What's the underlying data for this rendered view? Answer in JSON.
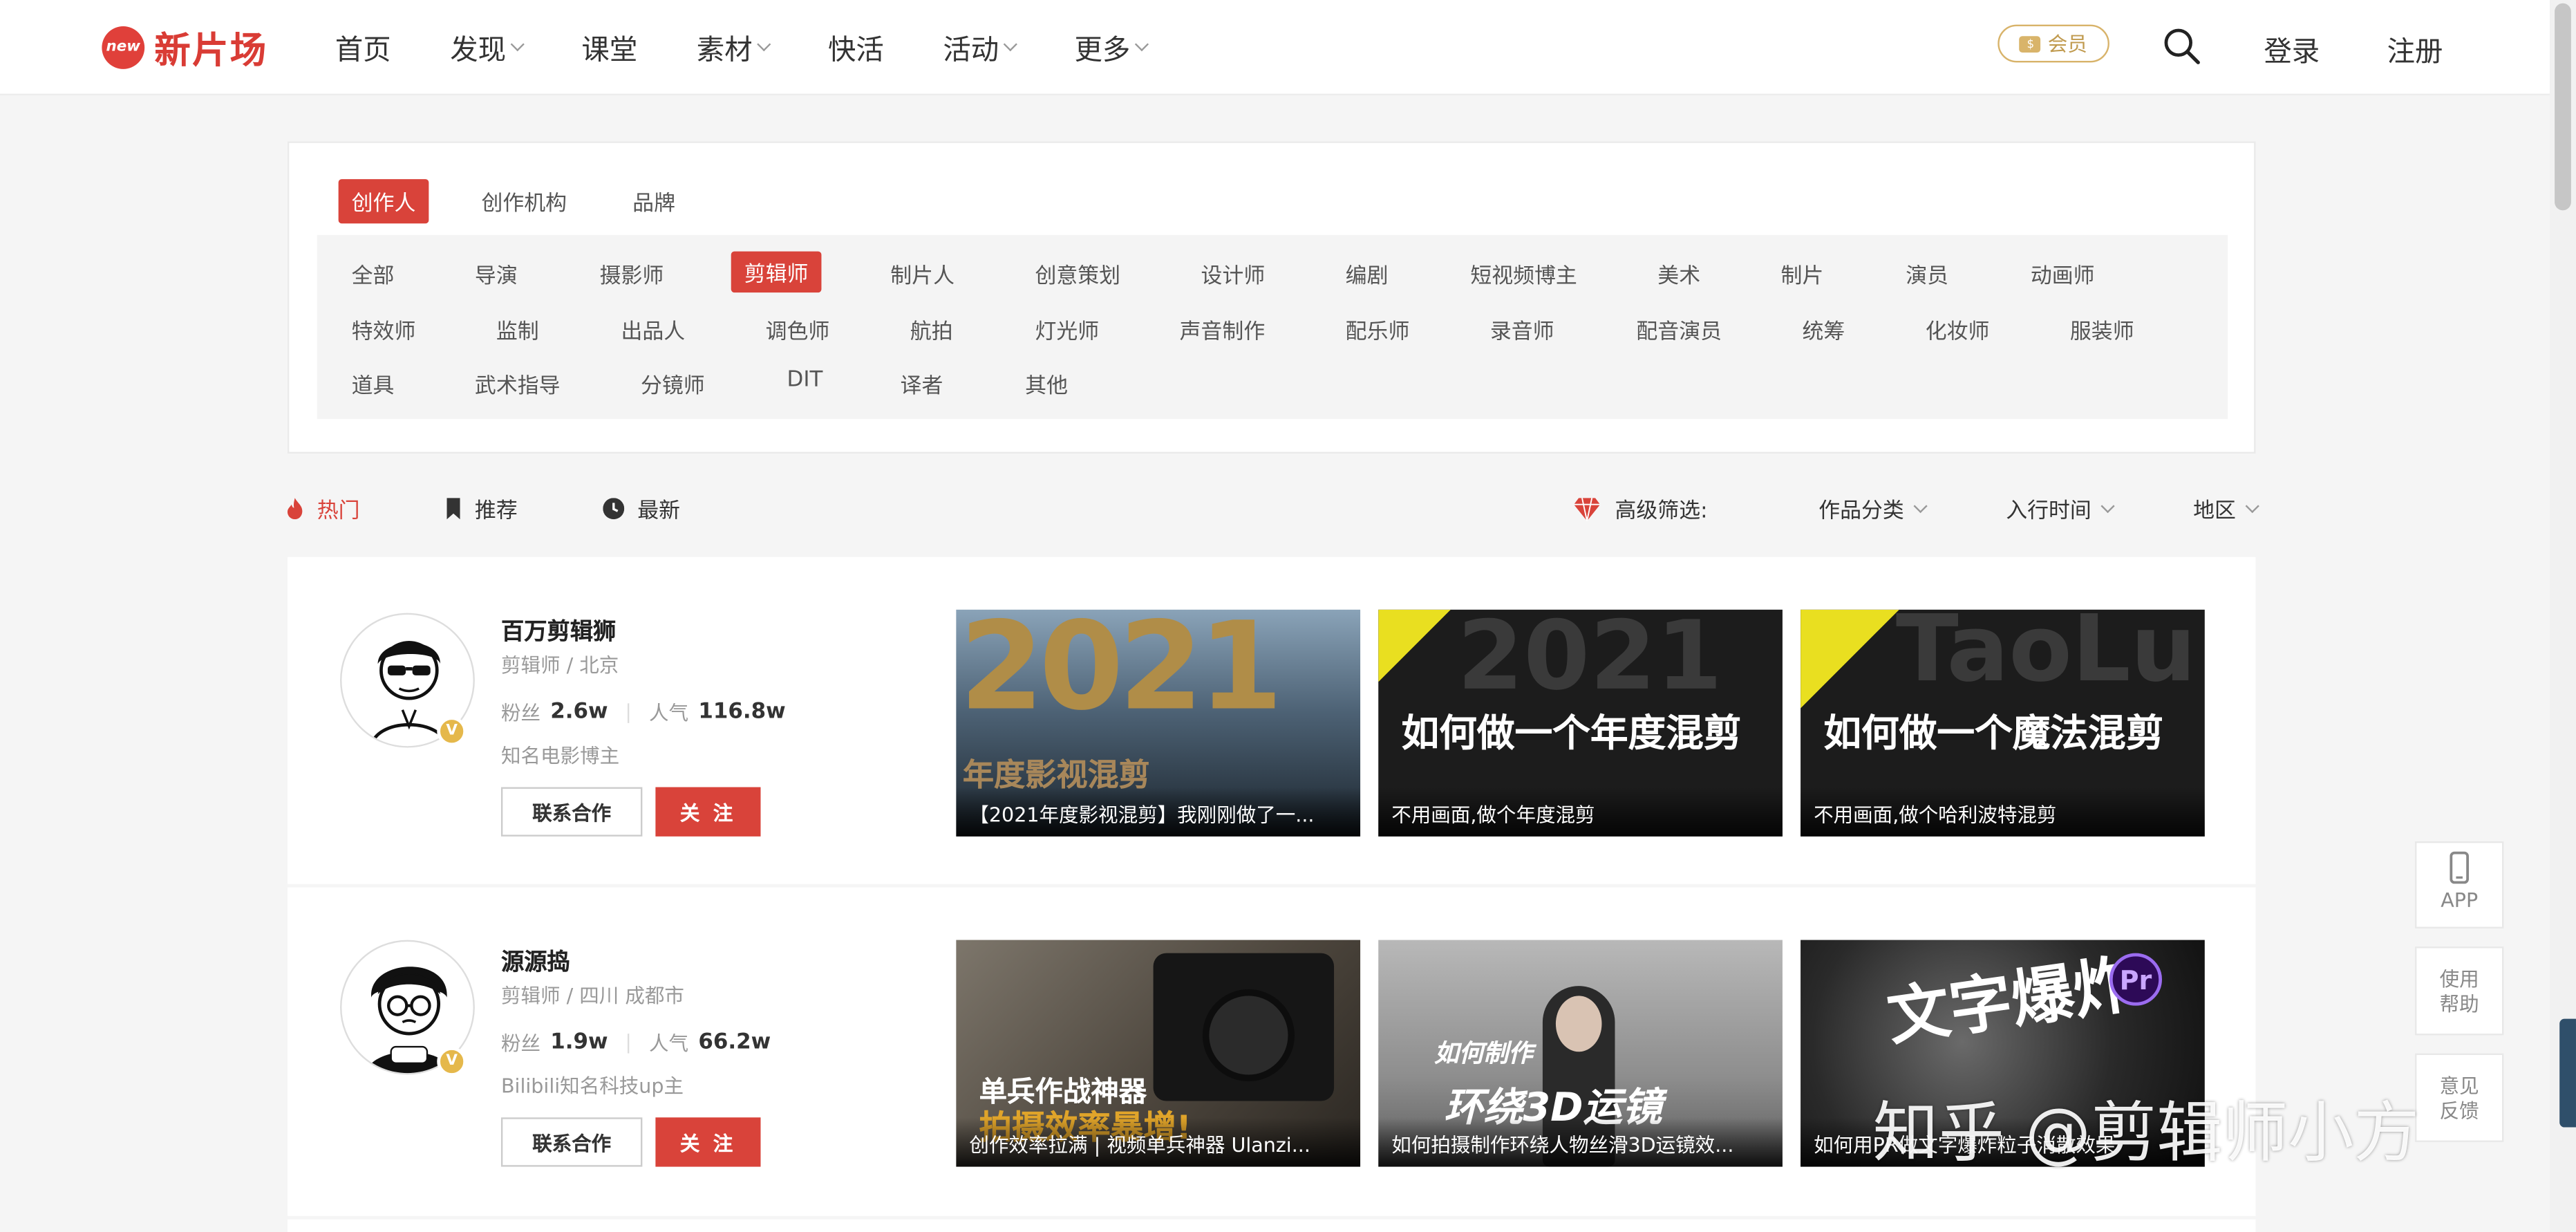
{
  "header": {
    "logo_badge": "new",
    "logo_text": "新片场",
    "nav": [
      "首页",
      "发现",
      "课堂",
      "素材",
      "快活",
      "活动",
      "更多"
    ],
    "vip_label": "会员",
    "login": "登录",
    "register": "注册"
  },
  "filter": {
    "tabs": [
      "创作人",
      "创作机构",
      "品牌"
    ],
    "categories": [
      "全部",
      "导演",
      "摄影师",
      "剪辑师",
      "制片人",
      "创意策划",
      "设计师",
      "编剧",
      "短视频博主",
      "美术",
      "制片",
      "演员",
      "动画师",
      "特效师",
      "监制",
      "出品人",
      "调色师",
      "航拍",
      "灯光师",
      "声音制作",
      "配乐师",
      "录音师",
      "配音演员",
      "统筹",
      "化妆师",
      "服装师",
      "道具",
      "武术指导",
      "分镜师",
      "DIT",
      "译者",
      "其他"
    ]
  },
  "sort": {
    "hot": "热门",
    "recommend": "推荐",
    "latest": "最新",
    "advanced": "高级筛选:",
    "work_type": "作品分类",
    "entry_time": "入行时间",
    "region": "地区"
  },
  "creators": [
    {
      "name": "百万剪辑狮",
      "role": "剪辑师 / 北京",
      "fans_label": "粉丝",
      "fans": "2.6w",
      "popularity_label": "人气",
      "popularity": "116.8w",
      "bio": "知名电影博主",
      "contact": "联系合作",
      "follow": "关 注",
      "videos": [
        {
          "caption": "【2021年度影视混剪】我刚刚做了一...",
          "art": "2021",
          "art2": "年度影视混剪"
        },
        {
          "caption": "不用画面,做个年度混剪",
          "art": "如何做一个年度混剪",
          "art2": "2021"
        },
        {
          "caption": "不用画面,做个哈利波特混剪",
          "art": "如何做一个魔法混剪",
          "art2": "TaoLu"
        }
      ]
    },
    {
      "name": "源源捣",
      "role": "剪辑师 / 四川 成都市",
      "fans_label": "粉丝",
      "fans": "1.9w",
      "popularity_label": "人气",
      "popularity": "66.2w",
      "bio": "Bilibili知名科技up主",
      "contact": "联系合作",
      "follow": "关 注",
      "videos": [
        {
          "caption": "创作效率拉满 | 视频单兵神器 Ulanzi...",
          "art": "单兵作战神器",
          "art2": "拍摄效率暴增!"
        },
        {
          "caption": "如何拍摄制作环绕人物丝滑3D运镜效...",
          "art": "如何制作",
          "art2": "环绕3D运镜"
        },
        {
          "caption": "如何用PR做文字爆炸粒子消散效果",
          "art": "文字爆炸",
          "art2": "Pr"
        }
      ]
    }
  ],
  "tools": {
    "app": "APP",
    "help": "使用帮助",
    "feedback": "意见反馈"
  },
  "watermark": "知乎 @剪辑师小方"
}
